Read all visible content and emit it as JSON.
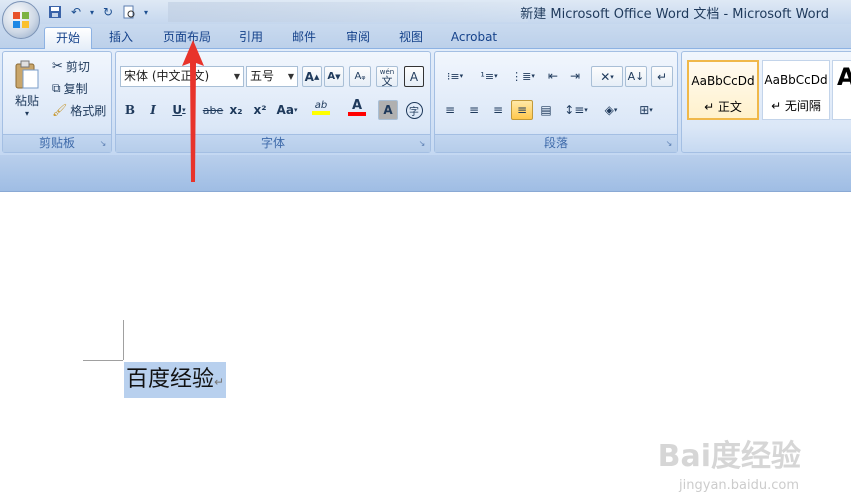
{
  "window": {
    "title": "新建 Microsoft Office Word 文档 - Microsoft Word"
  },
  "tabs": [
    {
      "label": "开始",
      "active": true
    },
    {
      "label": "插入"
    },
    {
      "label": "页面布局"
    },
    {
      "label": "引用"
    },
    {
      "label": "邮件"
    },
    {
      "label": "审阅"
    },
    {
      "label": "视图"
    },
    {
      "label": "Acrobat"
    }
  ],
  "clipboard": {
    "group_label": "剪贴板",
    "paste_label": "粘贴",
    "cut_label": "剪切",
    "copy_label": "复制",
    "format_painter_label": "格式刷"
  },
  "font": {
    "group_label": "字体",
    "font_name": "宋体 (中文正文)",
    "font_size": "五号",
    "bold": "B",
    "italic": "I",
    "underline": "U",
    "strike": "abe",
    "subscript": "x₂",
    "superscript": "x²",
    "change_case": "Aa",
    "grow": "A",
    "shrink": "A",
    "phonetic": "wén",
    "phonetic_char": "文",
    "border_char": "A",
    "highlight": "ab",
    "color_char": "A",
    "shade_char": "A",
    "enclose_char": "字"
  },
  "paragraph": {
    "group_label": "段落"
  },
  "styles": [
    {
      "sample": "AaBbCcDd",
      "name": "↵ 正文",
      "selected": true
    },
    {
      "sample": "AaBbCcDd",
      "name": "↵ 无间隔"
    },
    {
      "sample": "A",
      "name": ""
    }
  ],
  "document": {
    "text": "百度经验",
    "para_mark": "↵"
  },
  "watermark": {
    "text": "Bai度经验",
    "sub": "jingyan.baidu.com"
  },
  "colors": {
    "accent": "#15428b",
    "highlight": "#ffff00",
    "font_color": "#ff0000",
    "arrow": "#e8332b"
  }
}
